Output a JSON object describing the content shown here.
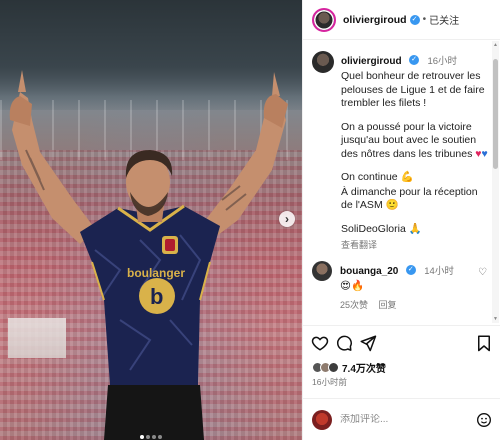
{
  "header": {
    "username": "oliviergiroud",
    "separator": "•",
    "follow_status": "已关注"
  },
  "caption": {
    "username": "oliviergiroud",
    "time": "16小时",
    "lines": [
      "Quel bonheur de retrouver les pelouses de Ligue 1 et de faire trembler les filets !",
      "On a poussé pour la victoire jusqu'au bout avec le soutien des nôtres dans les tribunes",
      "On continue",
      "À dimanche pour la réception de l'ASM",
      "SoliDeoGloria"
    ],
    "translate": "查看翻译"
  },
  "comment": {
    "username": "bouanga_20",
    "time": "14小时",
    "likes": "25次赞",
    "reply": "回复"
  },
  "likes": {
    "count_text": "7.4万次赞"
  },
  "post_time": "16小时前",
  "comment_box": {
    "placeholder": "添加评论..."
  },
  "jersey": {
    "sponsor": "boulanger"
  },
  "icons": {
    "like": "heart-icon",
    "comment": "comment-icon",
    "share": "share-icon",
    "save": "bookmark-icon",
    "emoji": "emoji-icon",
    "verified": "verified-badge-icon",
    "next": "chevron-right-icon"
  },
  "colors": {
    "verified": "#3897f0",
    "story_ring": "#d6249f",
    "jersey_navy": "#1b2350",
    "jersey_gold": "#d9b24a"
  }
}
